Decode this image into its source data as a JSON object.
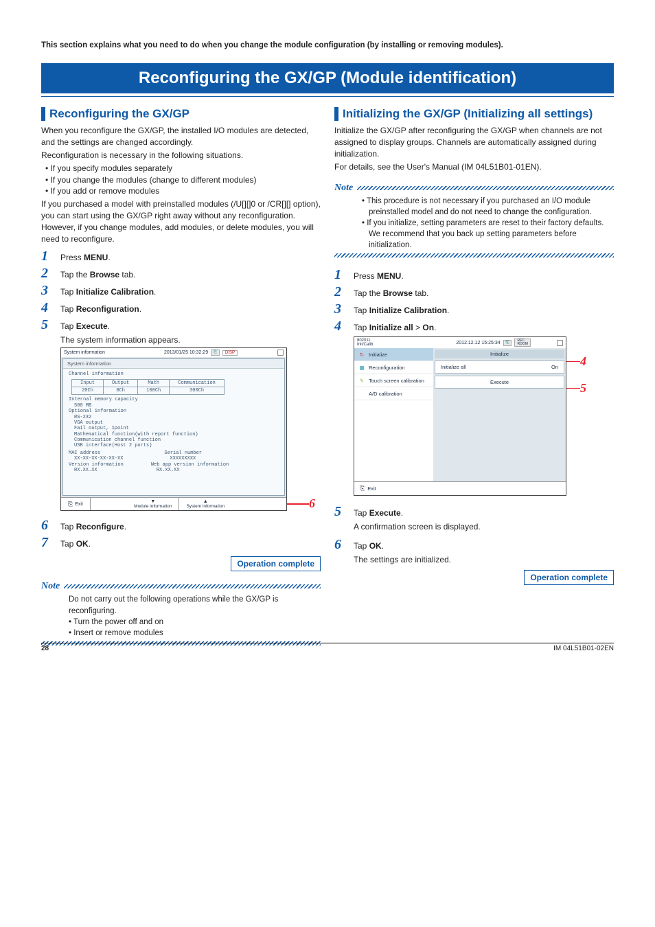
{
  "intro": "This section explains what you need to do when you change the module configuration (by installing or removing modules).",
  "page_title": "Reconfiguring the GX/GP (Module identification)",
  "left": {
    "heading": "Reconfiguring the GX/GP",
    "p1": "When you reconfigure the GX/GP, the installed I/O modules are detected, and the settings are changed accordingly.",
    "p2": "Reconfiguration is necessary in the following situations.",
    "bullets": [
      "If you specify modules separately",
      "If you change the modules (change to different modules)",
      "If you add or remove modules"
    ],
    "p3": "If you purchased a model with preinstalled modules (/U[][]0 or /CR[][] option), you can start using the GX/GP right away without any reconfiguration. However, if you change modules, add modules, or delete modules, you will need to reconfigure.",
    "steps": [
      {
        "pre": "Press ",
        "bold": "MENU",
        "post": "."
      },
      {
        "pre": "Tap the ",
        "bold": "Browse",
        "post": " tab."
      },
      {
        "pre": "Tap ",
        "bold": "Initialize Calibration",
        "post": "."
      },
      {
        "pre": "Tap ",
        "bold": "Reconfiguration",
        "post": "."
      },
      {
        "pre": "Tap ",
        "bold": "Execute",
        "post": ".",
        "sub": "The system information appears."
      },
      {
        "pre": "Tap ",
        "bold": "Reconfigure",
        "post": "."
      },
      {
        "pre": "Tap ",
        "bold": "OK",
        "post": "."
      }
    ],
    "operation_complete": "Operation complete",
    "note_title": "Note",
    "note_text": "Do not carry out the following operations while the GX/GP is reconfiguring.",
    "note_bullets": [
      "Turn the power off and on",
      "Insert or remove modules"
    ]
  },
  "right": {
    "heading": "Initializing the GX/GP (Initializing all settings)",
    "p1": "Initialize the GX/GP after reconfiguring the GX/GP when channels are not assigned to display groups. Channels are automatically assigned during initialization.",
    "p2": "For details, see the User's Manual (IM 04L51B01-01EN).",
    "note_title": "Note",
    "note_bullets": [
      "This procedure is not necessary if you purchased an I/O module preinstalled model and do not need to change the configuration.",
      "If you initialize, setting parameters are reset to their factory defaults. We recommend that you back up setting parameters before initialization."
    ],
    "steps": [
      {
        "pre": "Press ",
        "bold": "MENU",
        "post": "."
      },
      {
        "pre": "Tap the ",
        "bold": "Browse",
        "post": " tab."
      },
      {
        "pre": "Tap ",
        "bold": "Initialize Calibration",
        "post": "."
      },
      {
        "pre": "Tap ",
        "bold": "Initialize all",
        "post": " > ",
        "bold2": "On",
        "post2": "."
      },
      {
        "pre": "Tap ",
        "bold": "Execute",
        "post": ".",
        "sub": "A confirmation screen is displayed."
      },
      {
        "pre": "Tap ",
        "bold": "OK",
        "post": ".",
        "sub": "The settings are initialized."
      }
    ],
    "operation_complete": "Operation complete"
  },
  "screenshot1": {
    "title": "System information",
    "datetime": "2013/01/25 10:32:29",
    "disp_badge": "DISP",
    "inner_title": "System information",
    "channel_info": "Channel information",
    "cols": [
      "Input",
      "Output",
      "Math",
      "Communication"
    ],
    "vals": [
      "20Ch",
      "0Ch",
      "100Ch",
      "300Ch"
    ],
    "internal_memory": "Internal memory capacity",
    "internal_memory_val": "500 MB",
    "optional_info": "Optional information",
    "opts": [
      "RS-232",
      "VGA output",
      "Fail output, 1point",
      "Mathematical function(with report function)",
      "Communication channel function",
      "USB interface(Host 2 ports)"
    ],
    "mac_label": "MAC address",
    "mac_val": "XX-XX-XX-XX-XX-XX",
    "serial_label": "Serial number",
    "serial_val": "XXXXXXXXX",
    "ver_label": "Version information",
    "ver_val": "RX.XX.XX",
    "web_label": "Web app version information",
    "web_val": "RX.XX.XX",
    "exit": "Exit",
    "module_info": "Module information",
    "sys_info": "System information",
    "callout": "6"
  },
  "screenshot2": {
    "left_label": "802011\nInit/Calib",
    "datetime": "2012.12.12 15:25:34",
    "rec_badge": "REC\nROOM",
    "header": "Initialize",
    "sidebar": [
      "Initialize",
      "Reconfiguration",
      "Touch screen calibration",
      "A/D calibration"
    ],
    "main_row1_label": "Initialize all",
    "main_row1_val": "On",
    "main_row2": "Execute",
    "exit": "Exit",
    "callout4": "4",
    "callout5": "5"
  },
  "footer": {
    "page": "28",
    "doc": "IM 04L51B01-02EN"
  }
}
